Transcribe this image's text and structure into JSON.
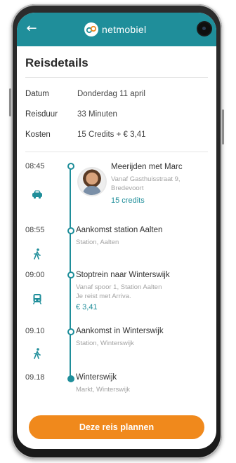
{
  "header": {
    "back_icon": "arrow-left-icon",
    "brand": "netmobiel",
    "accent_color": "#1f8e9a"
  },
  "page": {
    "title": "Reisdetails"
  },
  "details": [
    {
      "label": "Datum",
      "value": "Donderdag 11 april"
    },
    {
      "label": "Reisduur",
      "value": "33 Minuten"
    },
    {
      "label": "Kosten",
      "value": "15 Credits + € 3,41"
    }
  ],
  "timeline": [
    {
      "time": "08:45",
      "mode_icon": "car-icon",
      "title": "Meerijden met Marc",
      "sub": [
        "Vanaf Gasthuisstraat 9,",
        "Bredevoort"
      ],
      "accent": "15 credits"
    },
    {
      "time": "08:55",
      "mode_icon": "walk-icon",
      "title": "Aankomst station Aalten",
      "sub": [
        "Station, Aalten"
      ]
    },
    {
      "time": "09:00",
      "mode_icon": "train-icon",
      "title": "Stoptrein naar Winterswijk",
      "sub": [
        "Vanaf spoor 1, Station Aalten",
        "Je reist met Arriva."
      ],
      "accent": "€ 3,41"
    },
    {
      "time": "09.10",
      "mode_icon": "walk-icon",
      "title": "Aankomst in Winterswijk",
      "sub": [
        "Station, Winterswijk"
      ]
    },
    {
      "time": "09.18",
      "title": "Winterswijk",
      "sub": [
        "Markt, Winterswijk"
      ]
    }
  ],
  "cta": {
    "label": "Deze reis plannen",
    "color": "#f0891c"
  }
}
